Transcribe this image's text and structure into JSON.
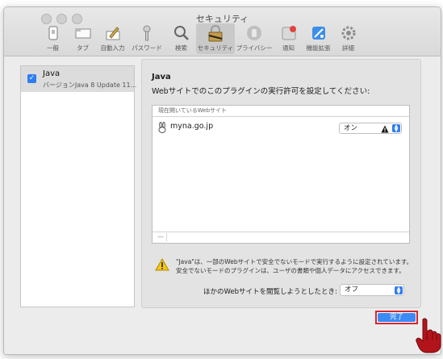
{
  "window": {
    "title": "セキュリティ"
  },
  "toolbar": {
    "items": [
      {
        "label": "一般",
        "icon": "general-icon"
      },
      {
        "label": "タブ",
        "icon": "tabs-icon"
      },
      {
        "label": "自動入力",
        "icon": "autofill-icon"
      },
      {
        "label": "パスワード",
        "icon": "key-icon"
      },
      {
        "label": "検索",
        "icon": "search-icon"
      },
      {
        "label": "セキュリティ",
        "icon": "lock-icon",
        "selected": true
      },
      {
        "label": "プライバシー",
        "icon": "hand-icon"
      },
      {
        "label": "通知",
        "icon": "notification-icon"
      },
      {
        "label": "機能拡張",
        "icon": "extensions-icon"
      },
      {
        "label": "詳細",
        "icon": "gear-icon"
      }
    ]
  },
  "sidebar": {
    "plugin": {
      "name": "Java",
      "version": "バージョンJava 8 Update 11...",
      "checked": true
    }
  },
  "panel": {
    "title": "Java",
    "description": "Webサイトでのこのプラグインの実行許可を設定してください:",
    "list_header": "現在開いているWebサイト",
    "site": {
      "name": "myna.go.jp",
      "setting": "オン"
    },
    "warning_line1": "\"Java\"は、一部のWebサイトで安全でないモードで実行するように設定されています。",
    "warning_line2": "安全でないモードのプラグインは、ユーザの書類や個人データにアクセスできます。",
    "other_label": "ほかのWebサイトを閲覧しようとしたとき:",
    "other_setting": "オフ"
  },
  "footer": {
    "done_label": "完了"
  },
  "colors": {
    "accent": "#2f7cf6",
    "highlight": "#d7262e"
  }
}
